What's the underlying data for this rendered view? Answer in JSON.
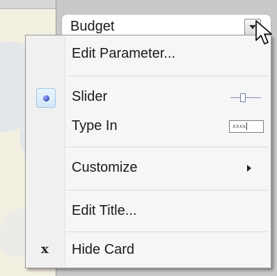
{
  "card": {
    "title": "Budget"
  },
  "menu": {
    "items": [
      {
        "label": "Edit Parameter..."
      },
      {
        "label": "Slider",
        "checked": true,
        "icon": "slider-preview-icon"
      },
      {
        "label": "Type In",
        "icon": "typein-preview-icon",
        "preview_text": "xxxx"
      },
      {
        "label": "Customize",
        "submenu": true
      },
      {
        "label": "Edit Title..."
      },
      {
        "label": "Hide Card",
        "mark": "x"
      }
    ]
  },
  "colors": {
    "menu_bg": "#f6f6f6",
    "selected_radio": "#1d2d9c",
    "highlight_box": "#d3e7f9"
  }
}
